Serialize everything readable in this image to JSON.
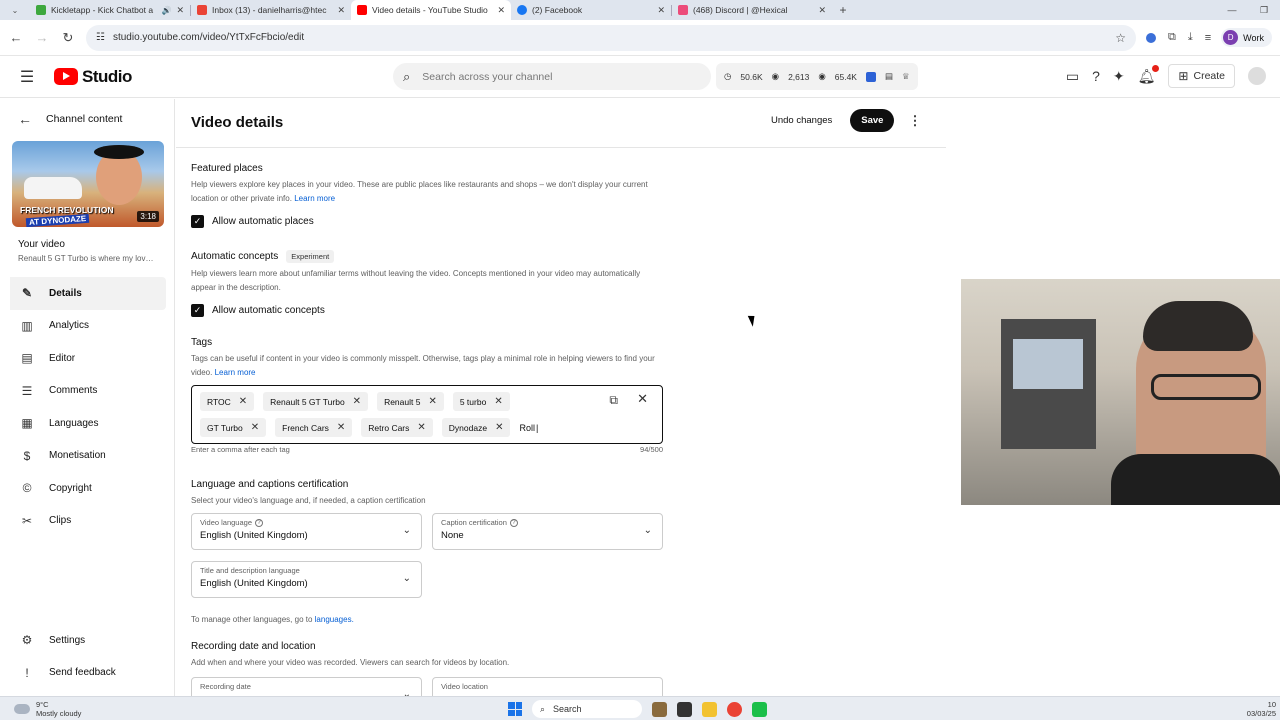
{
  "browser": {
    "tabs": [
      {
        "title": "Kickletapp - Kick Chatbot a",
        "icon_color": "#3ea83e",
        "active": false
      },
      {
        "title": "Inbox (13) - danielharris@htec",
        "icon_color": "#ea4335",
        "active": false
      },
      {
        "title": "Video details - YouTube Studio",
        "icon_color": "#ff0000",
        "active": true
      },
      {
        "title": "(2) Facebook",
        "icon_color": "#1877f2",
        "active": false
      },
      {
        "title": "(468) Discord | @Hexical",
        "icon_color": "#ec4c7a",
        "active": false
      }
    ],
    "url": "studio.youtube.com/video/YtTxFcFbcio/edit",
    "profile_initial": "D",
    "profile_label": "Work"
  },
  "header": {
    "logo_text": "Studio",
    "search_placeholder": "Search across your channel",
    "stats": [
      "50.6K",
      "2,613",
      "65.4K"
    ],
    "create_label": "Create"
  },
  "sidebar": {
    "back_label": "Channel content",
    "thumb_caption": "FRENCH REVOLUTION",
    "thumb_caption2": "AT DYNODAZE",
    "thumb_duration": "3:18",
    "your_video_label": "Your video",
    "video_title": "Renault 5 GT Turbo is where my love...",
    "items": [
      {
        "label": "Details",
        "icon": "pencil-icon",
        "glyph": "✎",
        "active": true
      },
      {
        "label": "Analytics",
        "icon": "analytics-icon",
        "glyph": "▥"
      },
      {
        "label": "Editor",
        "icon": "editor-icon",
        "glyph": "▤"
      },
      {
        "label": "Comments",
        "icon": "comments-icon",
        "glyph": "☰"
      },
      {
        "label": "Languages",
        "icon": "languages-icon",
        "glyph": "▦"
      },
      {
        "label": "Monetisation",
        "icon": "monetisation-icon",
        "glyph": "$"
      },
      {
        "label": "Copyright",
        "icon": "copyright-icon",
        "glyph": "©"
      },
      {
        "label": "Clips",
        "icon": "clips-icon",
        "glyph": "✂"
      }
    ],
    "bottom": [
      {
        "label": "Settings",
        "icon": "settings-icon",
        "glyph": "⚙"
      },
      {
        "label": "Send feedback",
        "icon": "feedback-icon",
        "glyph": "!"
      }
    ]
  },
  "main": {
    "title": "Video details",
    "undo_label": "Undo changes",
    "save_label": "Save",
    "featured_places": {
      "heading": "Featured places",
      "desc": "Help viewers explore key places in your video. These are public places like restaurants and shops – we don't display your current location or other private info.",
      "learn_more": "Learn more",
      "checkbox_label": "Allow automatic places"
    },
    "automatic_concepts": {
      "heading": "Automatic concepts",
      "badge": "Experiment",
      "desc": "Help viewers learn more about unfamiliar terms without leaving the video. Concepts mentioned in your video may automatically appear in the description.",
      "checkbox_label": "Allow automatic concepts"
    },
    "tags": {
      "heading": "Tags",
      "desc": "Tags can be useful if content in your video is commonly misspelt. Otherwise, tags play a minimal role in helping viewers to find your video.",
      "learn_more": "Learn more",
      "row1": [
        "RTOC",
        "Renault 5 GT Turbo",
        "Renault 5",
        "5 turbo"
      ],
      "row2": [
        "GT Turbo",
        "French Cars",
        "Retro Cars",
        "Dynodaze"
      ],
      "typing": "Roll",
      "hint": "Enter a comma after each tag",
      "count": "94/500"
    },
    "language": {
      "heading": "Language and captions certification",
      "desc": "Select your video's language and, if needed, a caption certification",
      "video_language_label": "Video language",
      "video_language_value": "English (United Kingdom)",
      "caption_label": "Caption certification",
      "caption_value": "None",
      "title_lang_label": "Title and description language",
      "title_lang_value": "English (United Kingdom)",
      "manage_text": "To manage other languages, go to",
      "manage_link": "languages."
    },
    "recording": {
      "heading": "Recording date and location",
      "desc": "Add when and where your video was recorded. Viewers can search for videos by location.",
      "date_label": "Recording date",
      "location_label": "Video location"
    }
  },
  "taskbar": {
    "temp": "9°C",
    "weather": "Mostly cloudy",
    "search": "Search",
    "time": "10",
    "date": "03/03/25"
  }
}
